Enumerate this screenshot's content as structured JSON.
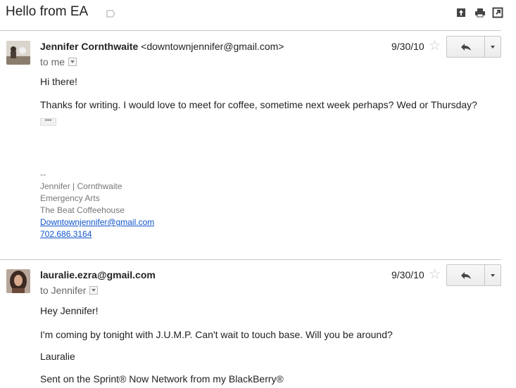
{
  "thread": {
    "subject": "Hello from EA",
    "icons": [
      "label-icon",
      "archive-icon",
      "print-icon",
      "new-window-icon"
    ]
  },
  "messages": [
    {
      "sender_name": "Jennifer Cornthwaite",
      "sender_email": "<downtownjennifer@gmail.com>",
      "to": "to me",
      "date": "9/30/10",
      "body": [
        "Hi there!",
        "Thanks for writing. I would love to meet for coffee, sometime next week perhaps? Wed or Thursday?"
      ],
      "ellipsis": "•••",
      "signature": {
        "separator": "--",
        "lines": [
          "Jennifer | Cornthwaite",
          "Emergency Arts",
          "The Beat Coffeehouse"
        ],
        "email_link": "Downtownjennifer@gmail.com",
        "phone_link": "702.686.3164"
      }
    },
    {
      "sender_name": "lauralie.ezra@gmail.com",
      "to": "to Jennifer",
      "date": "9/30/10",
      "body": [
        "Hey Jennifer!",
        "I'm coming by tonight with J.U.M.P. Can't wait to touch base. Will you be around?",
        "Lauralie",
        "Sent on the Sprint® Now Network from my BlackBerry®"
      ]
    }
  ],
  "colors": {
    "link": "#1155cc",
    "divider": "#c8c8c8",
    "star": "#c9c9c9"
  }
}
